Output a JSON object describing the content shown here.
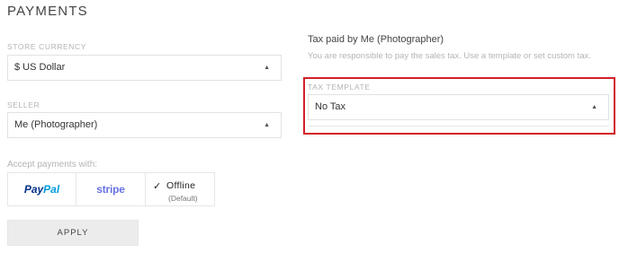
{
  "payments": {
    "title": "PAYMENTS",
    "store_currency": {
      "label": "STORE CURRENCY",
      "value": "$ US Dollar"
    },
    "seller": {
      "label": "SELLER",
      "value": "Me (Photographer)"
    },
    "accept_label": "Accept payments with:",
    "methods": {
      "paypal": {
        "pay": "Pay",
        "pal": "Pal"
      },
      "stripe": "stripe",
      "offline": {
        "check": "✓",
        "label": "Offline",
        "sub": "(Default)",
        "selected": true
      }
    },
    "apply_label": "APPLY"
  },
  "tax": {
    "heading": "Tax paid by Me (Photographer)",
    "description": "You are responsible to pay the sales tax. Use a template or set custom tax.",
    "template": {
      "label": "TAX TEMPLATE",
      "value": "No Tax"
    }
  },
  "icons": {
    "caret": "▲"
  },
  "colors": {
    "highlight": "#d31f27",
    "paypal_dark": "#003087",
    "paypal_light": "#009cde",
    "stripe": "#6772e5",
    "apply_bg": "#ececec"
  }
}
